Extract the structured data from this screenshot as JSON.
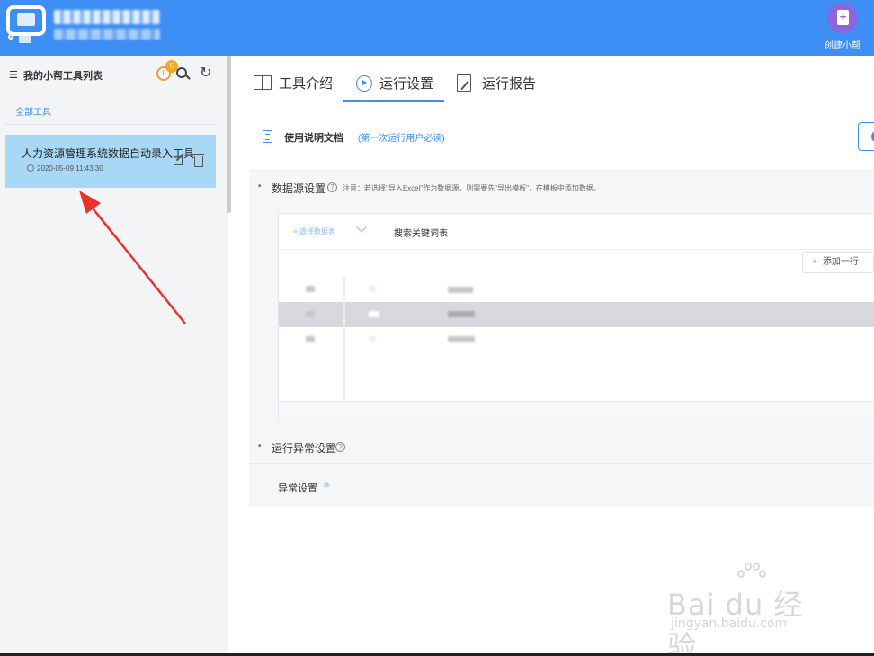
{
  "header": {
    "create_label": "创建小帮"
  },
  "sidebar": {
    "title": "我的小帮工具列表",
    "reminder_count": "5",
    "all_tools": "全部工具",
    "tool": {
      "name": "人力资源管理系统数据自动录入工具",
      "date": "2020-05-09 11:43:30"
    }
  },
  "tabs": [
    {
      "label": "工具介绍"
    },
    {
      "label": "运行设置"
    },
    {
      "label": "运行报告"
    }
  ],
  "doc": {
    "label": "使用说明文档",
    "hint": "(第一次运行用户必读)"
  },
  "datasource": {
    "title": "数据源设置",
    "note": "注意：若选择\"导入Excel\"作为数据源，则需要先\"导出模板\"，在模板中添加数据。",
    "select_placeholder": "选择数据表",
    "table_name": "搜索关键词表",
    "add_row": "添加一行"
  },
  "exception": {
    "title": "运行异常设置",
    "label": "异常设置"
  },
  "watermark": {
    "brand": "Bai du 经验",
    "site": "jingyan.baidu.com"
  },
  "colors": {
    "header": "#3d8ef5",
    "sidebar": "#f2f4f6",
    "selected_card": "#a8d8f6",
    "accent": "#3d8ef5",
    "badge": "#f5a623",
    "arrow": "#e8322b"
  }
}
